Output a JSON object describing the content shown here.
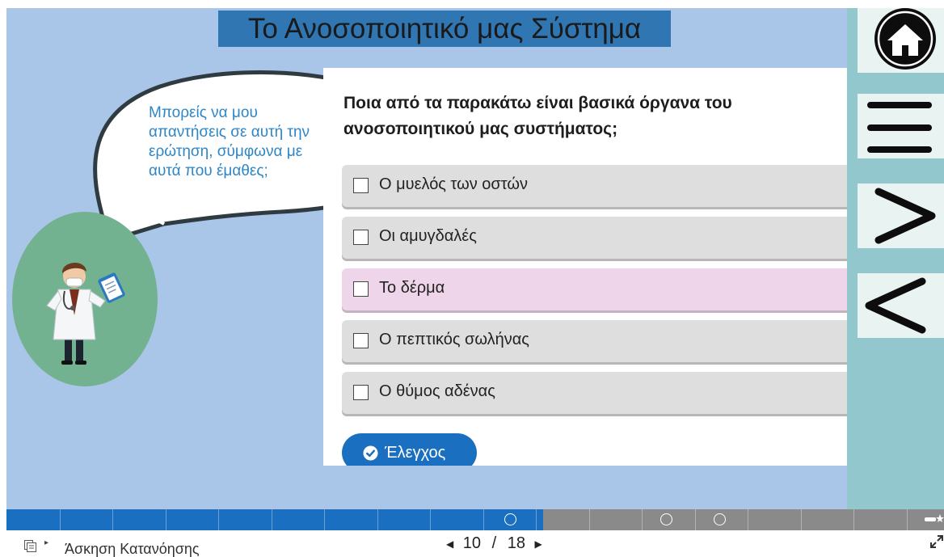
{
  "slide": {
    "title": "Το Ανοσοποιητικό μας Σύστημα",
    "speech_bubble": "Μπορείς να μου απαντήσεις σε αυτή την ερώτηση, σύμφωνα με αυτά που έμαθες;"
  },
  "quiz": {
    "question": "Ποια από τα παρακάτω είναι βασικά όργανα του ανοσοποιητικού μας συστήματος;",
    "options": [
      {
        "label": "Ο μυελός των οστών",
        "checked": false
      },
      {
        "label": "Οι αμυγδαλές",
        "checked": false
      },
      {
        "label": "Το δέρμα",
        "checked": false,
        "highlighted": true
      },
      {
        "label": "Ο πεπτικός σωλήνας",
        "checked": false
      },
      {
        "label": "Ο θύμος αδένας",
        "checked": false
      }
    ],
    "check_button": "Έλεγχος"
  },
  "nav_buttons": [
    {
      "name": "home",
      "icon": "home-icon"
    },
    {
      "name": "menu",
      "icon": "hamburger-menu-icon"
    },
    {
      "name": "next",
      "icon": "chevron-right-icon"
    },
    {
      "name": "previous",
      "icon": "chevron-left-icon"
    }
  ],
  "progress": {
    "current": 10,
    "total": 18,
    "fill_fraction": 0.572,
    "separator": "/"
  },
  "footer": {
    "slide_name": "Άσκηση Κατανόησης",
    "toc_icon": "table-of-contents-icon",
    "expand_icon": "fullscreen-expand-icon"
  },
  "colors": {
    "slide_background": "#a9c6e9",
    "title_background": "#2f76b3",
    "nav_panel": "#92c7cd",
    "progress_fill": "#1a6fc0",
    "progress_rest": "#8a8a8a",
    "option_background": "#dedede",
    "option_highlight": "#efd5ea",
    "check_button": "#1b6fc1",
    "bubble_text": "#2f86c6"
  }
}
